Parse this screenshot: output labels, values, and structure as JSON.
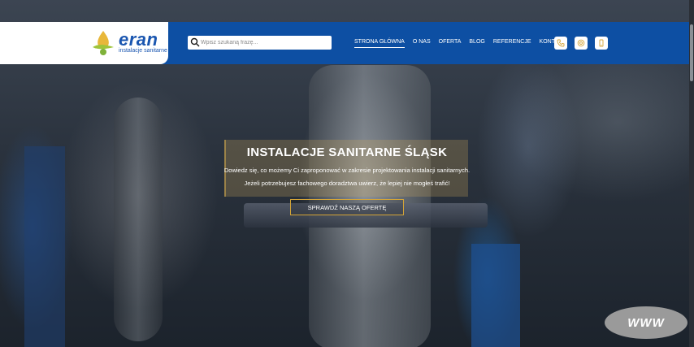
{
  "brand": {
    "name": "eran",
    "tagline": "instalacje sanitarne",
    "accent": "#0d4fa3",
    "gold": "#d4a437"
  },
  "search": {
    "placeholder": "Wpisz szukaną frazę..."
  },
  "nav": {
    "items": [
      {
        "label": "STRONA GŁÓWNA",
        "active": true
      },
      {
        "label": "O NAS"
      },
      {
        "label": "OFERTA"
      },
      {
        "label": "BLOG"
      },
      {
        "label": "REFERENCJE"
      },
      {
        "label": "KONTAKT"
      }
    ]
  },
  "header_icons": [
    "phone-icon",
    "email-icon",
    "mobile-icon"
  ],
  "hero": {
    "title": "INSTALACJE SANITARNE ŚLĄSK",
    "line1": "Dowiedz się, co możemy Ci zaproponować w zakresie projektowania instalacji sanitarnych.",
    "line2": "Jeżeli potrzebujesz fachowego doradztwa uwierz, że lepiej nie mogłeś trafić!",
    "cta_label": "SPRAWDŹ NASZĄ OFERTĘ"
  },
  "badge": {
    "label": "WWW"
  }
}
